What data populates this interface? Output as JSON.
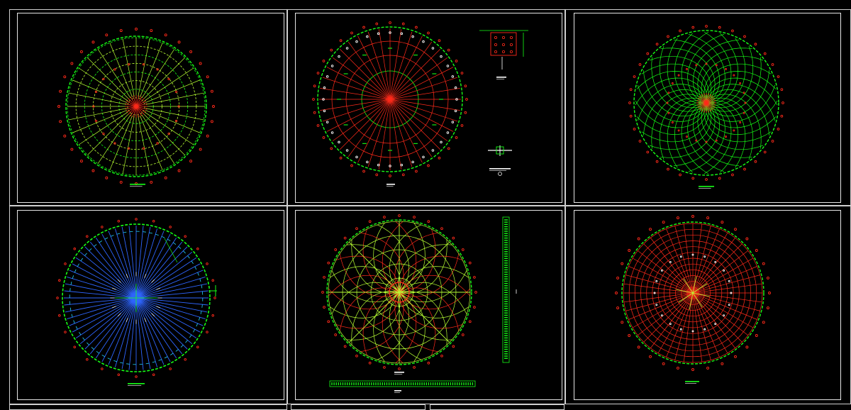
{
  "viewer": {
    "background": "#000000",
    "frame_color": "#d8d8d8"
  },
  "colors": {
    "red": "#ff2a1a",
    "green": "#16ff16",
    "yellow_green": "#b8ff33",
    "blue": "#2f66ff",
    "cyan": "#22d6ff",
    "white": "#ffffff",
    "title_cyan": "#38e8ff"
  },
  "drawings": [
    {
      "id": "plan-1",
      "scheme": "rings-and-rays",
      "primary": "#b8ff33",
      "secondary": "#ff2a1a",
      "title_text": ""
    },
    {
      "id": "plan-2",
      "scheme": "radial-red",
      "primary": "#ff2a1a",
      "secondary": "#16ff16",
      "title_text": ""
    },
    {
      "id": "plan-3",
      "scheme": "lamella",
      "primary": "#16ff16",
      "secondary": "#ff2a1a",
      "title_text": ""
    },
    {
      "id": "plan-4",
      "scheme": "radial-blue",
      "primary": "#2f66ff",
      "secondary": "#16ff16",
      "title_text": ""
    },
    {
      "id": "plan-5",
      "scheme": "geodesic",
      "primary": "#b8ff33",
      "secondary": "#ff2a1a",
      "title_text": ""
    },
    {
      "id": "plan-6",
      "scheme": "radial-red-grid",
      "primary": "#ff2a1a",
      "secondary": "#16ff16",
      "title_text": ""
    }
  ]
}
